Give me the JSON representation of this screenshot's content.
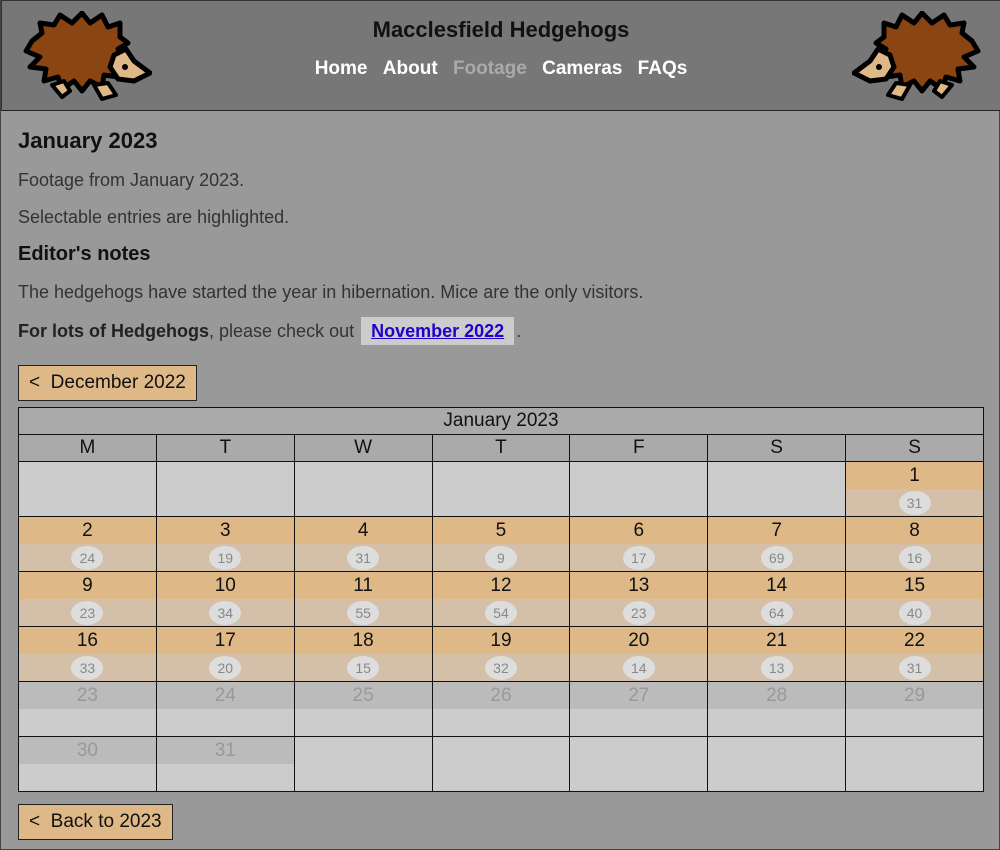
{
  "header": {
    "title": "Macclesfield Hedgehogs",
    "nav": [
      {
        "label": "Home",
        "current": false
      },
      {
        "label": "About",
        "current": false
      },
      {
        "label": "Footage",
        "current": true
      },
      {
        "label": "Cameras",
        "current": false
      },
      {
        "label": "FAQs",
        "current": false
      }
    ],
    "logo_icon": "hedgehog-icon"
  },
  "page": {
    "title": "January 2023",
    "intro": "Footage from January 2023.",
    "hint": "Selectable entries are highlighted.",
    "notes_heading": "Editor's notes",
    "notes_text": "The hedgehogs have started the year in hibernation. Mice are the only visitors.",
    "recommend_bold": "For lots of Hedgehogs",
    "recommend_text": ", please check out",
    "recommend_link": "November 2022",
    "recommend_end": "."
  },
  "prev_button": {
    "arrow": "<",
    "label": "December 2022"
  },
  "back_button": {
    "arrow": "<",
    "label": "Back to 2023"
  },
  "calendar": {
    "title": "January 2023",
    "weekdays": [
      "M",
      "T",
      "W",
      "T",
      "F",
      "S",
      "S"
    ],
    "weeks": [
      [
        null,
        null,
        null,
        null,
        null,
        null,
        {
          "day": "1",
          "count": "31",
          "active": true
        }
      ],
      [
        {
          "day": "2",
          "count": "24",
          "active": true
        },
        {
          "day": "3",
          "count": "19",
          "active": true
        },
        {
          "day": "4",
          "count": "31",
          "active": true
        },
        {
          "day": "5",
          "count": "9",
          "active": true
        },
        {
          "day": "6",
          "count": "17",
          "active": true
        },
        {
          "day": "7",
          "count": "69",
          "active": true
        },
        {
          "day": "8",
          "count": "16",
          "active": true
        }
      ],
      [
        {
          "day": "9",
          "count": "23",
          "active": true
        },
        {
          "day": "10",
          "count": "34",
          "active": true
        },
        {
          "day": "11",
          "count": "55",
          "active": true
        },
        {
          "day": "12",
          "count": "54",
          "active": true
        },
        {
          "day": "13",
          "count": "23",
          "active": true
        },
        {
          "day": "14",
          "count": "64",
          "active": true
        },
        {
          "day": "15",
          "count": "40",
          "active": true
        }
      ],
      [
        {
          "day": "16",
          "count": "33",
          "active": true
        },
        {
          "day": "17",
          "count": "20",
          "active": true
        },
        {
          "day": "18",
          "count": "15",
          "active": true
        },
        {
          "day": "19",
          "count": "32",
          "active": true
        },
        {
          "day": "20",
          "count": "14",
          "active": true
        },
        {
          "day": "21",
          "count": "13",
          "active": true
        },
        {
          "day": "22",
          "count": "31",
          "active": true
        }
      ],
      [
        {
          "day": "23",
          "active": false
        },
        {
          "day": "24",
          "active": false
        },
        {
          "day": "25",
          "active": false
        },
        {
          "day": "26",
          "active": false
        },
        {
          "day": "27",
          "active": false
        },
        {
          "day": "28",
          "active": false
        },
        {
          "day": "29",
          "active": false
        }
      ],
      [
        {
          "day": "30",
          "active": false
        },
        {
          "day": "31",
          "active": false
        },
        null,
        null,
        null,
        null,
        null
      ]
    ]
  },
  "colors": {
    "background": "#999999",
    "header": "#777777",
    "active_day": "#deb887",
    "active_count_row": "#d4c0a8",
    "inactive_day": "#bbbbbb",
    "link": "#2200cc"
  }
}
